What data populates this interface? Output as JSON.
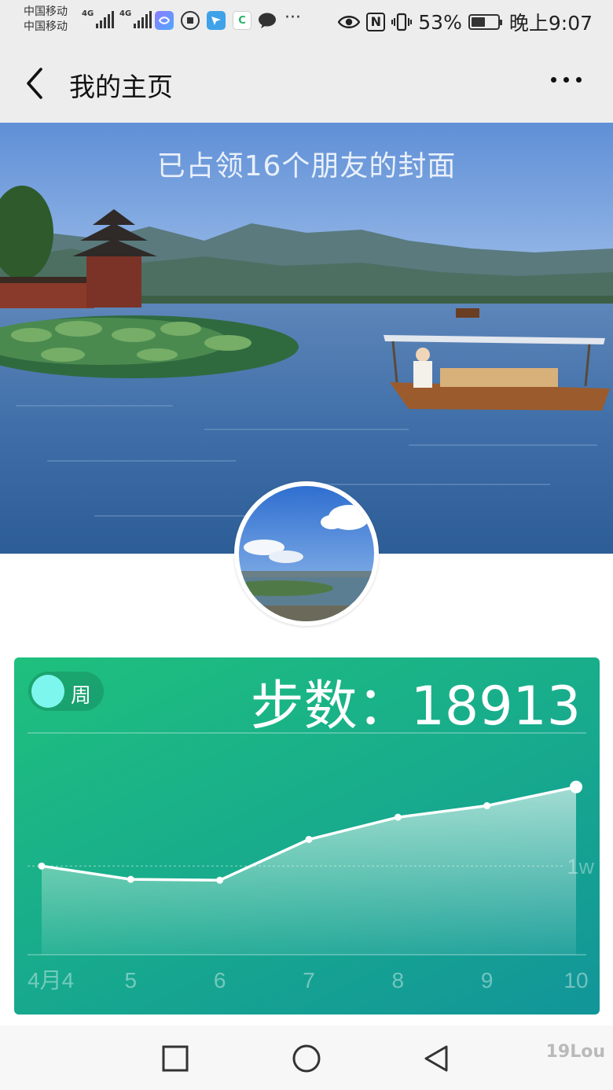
{
  "status_bar": {
    "carrier_1": "中国移动",
    "carrier_2": "中国移动",
    "network_1": "4G",
    "network_2": "4G",
    "battery_percent": "53%",
    "time": "晚上9:07",
    "nfc_label": "N",
    "app_icon_c": "C",
    "more": "···",
    "battery_level": 0.53
  },
  "nav": {
    "title": "我的主页"
  },
  "cover": {
    "caption": "已占领16个朋友的封面"
  },
  "card": {
    "toggle_label": "周",
    "steps_label": "步数：",
    "steps_value": "18913",
    "accent_color": "#7df7ee"
  },
  "chart_data": {
    "type": "area",
    "x": [
      "4月4",
      "5",
      "6",
      "7",
      "8",
      "9",
      "10"
    ],
    "y_reference_label": "1w",
    "y_reference_value": 10000,
    "series": [
      {
        "values": [
          10000,
          8500,
          8400,
          13000,
          15500,
          16800,
          18913
        ]
      }
    ],
    "ylim": [
      0,
      25000
    ],
    "line_color": "#ffffff"
  },
  "system_nav": {
    "watermark": "19Lou"
  }
}
